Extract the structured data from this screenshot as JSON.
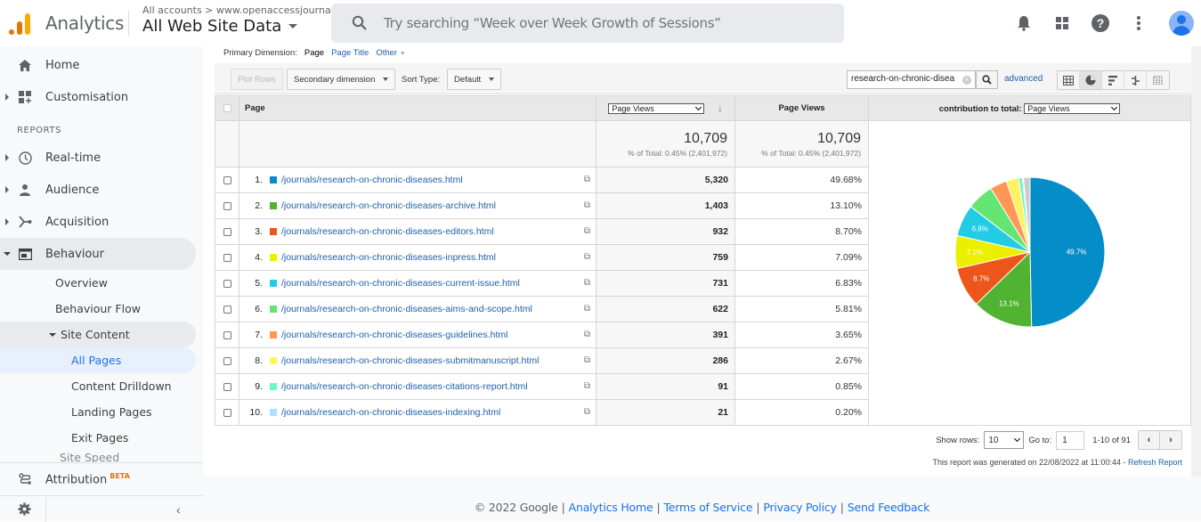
{
  "header": {
    "app_name": "Analytics",
    "account_path": "All accounts > www.openaccessjourna...",
    "view_name": "All Web Site Data",
    "search_placeholder": "Try searching “Week over Week Growth of Sessions”",
    "icons": [
      "bell-icon",
      "apps-grid-icon",
      "help-icon",
      "more-vert-icon",
      "account-avatar-icon"
    ]
  },
  "sidebar": {
    "top_items": [
      {
        "label": "Home",
        "icon": "home-icon"
      },
      {
        "label": "Customisation",
        "icon": "dashboard-icon"
      }
    ],
    "reports_label": "REPORTS",
    "report_items": [
      {
        "label": "Real-time",
        "icon": "clock-icon"
      },
      {
        "label": "Audience",
        "icon": "person-icon"
      },
      {
        "label": "Acquisition",
        "icon": "acquisition-icon"
      },
      {
        "label": "Behaviour",
        "icon": "behaviour-icon"
      }
    ],
    "behaviour_sub": [
      "Overview",
      "Behaviour Flow"
    ],
    "site_content_label": "Site Content",
    "site_content_sub": [
      "All Pages",
      "Content Drilldown",
      "Landing Pages",
      "Exit Pages"
    ],
    "site_speed_label": "Site Speed",
    "attribution_label": "Attribution",
    "attribution_badge": "BETA",
    "selected": "All Pages"
  },
  "report": {
    "primary_dimension_label": "Primary Dimension:",
    "primary_dimensions": [
      "Page",
      "Page Title",
      "Other"
    ],
    "plot_rows_label": "Plot Rows",
    "secondary_dimension_label": "Secondary dimension",
    "sort_type_label": "Sort Type:",
    "sort_type_value": "Default",
    "filter_value": "research-on-chronic-disea",
    "advanced_label": "advanced",
    "view_modes": [
      "data-table-icon",
      "pie-chart-icon",
      "performance-bar-icon",
      "comparison-icon",
      "pivot-icon"
    ],
    "active_view": "pie-chart-icon",
    "columns": {
      "page": "Page",
      "metric_select": "Page Views",
      "metric2": "Page Views",
      "contribution_label": "contribution to total:",
      "contribution_select": "Page Views"
    },
    "totals": {
      "value": "10,709",
      "pct_note": "% of Total: 0.45% (2,401,972)",
      "value2": "10,709",
      "pct_note2": "% of Total: 0.45% (2,401,972)"
    },
    "rows": [
      {
        "n": "1.",
        "page": "/journals/research-on-chronic-diseases.html",
        "views": "5,320",
        "pct": "49.68%",
        "color": "#058dc7"
      },
      {
        "n": "2.",
        "page": "/journals/research-on-chronic-diseases-archive.html",
        "views": "1,403",
        "pct": "13.10%",
        "color": "#50b432"
      },
      {
        "n": "3.",
        "page": "/journals/research-on-chronic-diseases-editors.html",
        "views": "932",
        "pct": "8.70%",
        "color": "#ed561b"
      },
      {
        "n": "4.",
        "page": "/journals/research-on-chronic-diseases-inpress.html",
        "views": "759",
        "pct": "7.09%",
        "color": "#edef00"
      },
      {
        "n": "5.",
        "page": "/journals/research-on-chronic-diseases-current-issue.html",
        "views": "731",
        "pct": "6.83%",
        "color": "#24cbe5"
      },
      {
        "n": "6.",
        "page": "/journals/research-on-chronic-diseases-aims-and-scope.html",
        "views": "622",
        "pct": "5.81%",
        "color": "#64e572"
      },
      {
        "n": "7.",
        "page": "/journals/research-on-chronic-diseases-guidelines.html",
        "views": "391",
        "pct": "3.65%",
        "color": "#ff9655"
      },
      {
        "n": "8.",
        "page": "/journals/research-on-chronic-diseases-submitmanuscript.html",
        "views": "286",
        "pct": "2.67%",
        "color": "#fff263"
      },
      {
        "n": "9.",
        "page": "/journals/research-on-chronic-diseases-citations-report.html",
        "views": "91",
        "pct": "0.85%",
        "color": "#6af9c4"
      },
      {
        "n": "10.",
        "page": "/journals/research-on-chronic-diseases-indexing.html",
        "views": "21",
        "pct": "0.20%",
        "color": "#b2deff"
      }
    ],
    "pager": {
      "show_rows_label": "Show rows:",
      "show_rows_value": "10",
      "goto_label": "Go to:",
      "goto_value": "1",
      "range": "1-10 of 91"
    },
    "generated_note": "This report was generated on 22/08/2022 at 11:00:44 - ",
    "refresh_label": "Refresh Report"
  },
  "chart_data": {
    "type": "pie",
    "title": "contribution to total: Page Views",
    "categories": [
      "/journals/research-on-chronic-diseases.html",
      "/journals/research-on-chronic-diseases-archive.html",
      "/journals/research-on-chronic-diseases-editors.html",
      "/journals/research-on-chronic-diseases-inpress.html",
      "/journals/research-on-chronic-diseases-current-issue.html",
      "/journals/research-on-chronic-diseases-aims-and-scope.html",
      "/journals/research-on-chronic-diseases-guidelines.html",
      "/journals/research-on-chronic-diseases-submitmanuscript.html",
      "/journals/research-on-chronic-diseases-citations-report.html",
      "/journals/research-on-chronic-diseases-indexing.html",
      "(other)"
    ],
    "values": [
      49.68,
      13.1,
      8.7,
      7.09,
      6.83,
      5.81,
      3.65,
      2.67,
      0.85,
      0.2,
      1.42
    ],
    "colors": [
      "#058dc7",
      "#50b432",
      "#ed561b",
      "#edef00",
      "#24cbe5",
      "#64e572",
      "#ff9655",
      "#fff263",
      "#6af9c4",
      "#b2deff",
      "#cccccc"
    ],
    "data_labels": [
      "49.7%",
      "13.1%",
      "8.7%",
      "7.1%",
      "6.8%",
      "",
      "",
      "",
      "",
      "",
      ""
    ],
    "legend": "none"
  },
  "footer": {
    "copyright": "© 2022 Google",
    "links": [
      "Analytics Home",
      "Terms of Service",
      "Privacy Policy",
      "Send Feedback"
    ]
  }
}
